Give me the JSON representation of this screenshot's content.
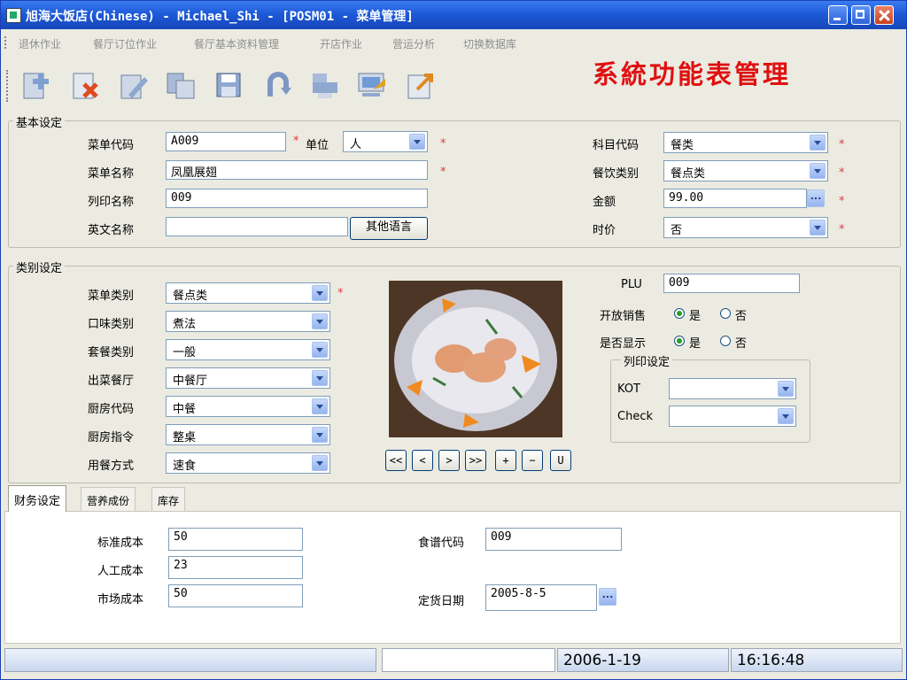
{
  "window": {
    "title": "旭海大饭店(Chinese) - Michael_Shi - [POSM01 - 菜单管理]"
  },
  "menu": [
    "退休作业",
    "餐厅订位作业",
    "餐厅基本资料管理",
    "开店作业",
    "营运分析",
    "切换数据库"
  ],
  "toolbar": {
    "buttons": [
      {
        "name": "add-icon"
      },
      {
        "name": "delete-icon"
      },
      {
        "name": "edit-icon"
      },
      {
        "name": "copy-icon"
      },
      {
        "name": "save-icon"
      },
      {
        "name": "undo-icon"
      },
      {
        "name": "print-icon"
      },
      {
        "name": "search-icon"
      },
      {
        "name": "exit-icon"
      }
    ]
  },
  "banner": "系統功能表管理",
  "basic": {
    "legend": "基本设定",
    "menu_code_label": "菜单代码",
    "menu_code": "A009",
    "unit_label": "单位",
    "unit": "人",
    "menu_name_label": "菜单名称",
    "menu_name": "凤凰展翅",
    "print_name_label": "列印名称",
    "print_name": "009",
    "english_name_label": "英文名称",
    "english_name": "",
    "other_lang_button": "其他语言",
    "account_code_label": "科目代码",
    "account_code": "餐类",
    "meal_type_label": "餐饮类别",
    "meal_type": "餐点类",
    "amount_label": "金额",
    "amount": "99.00",
    "current_price_label": "时价",
    "current_price": "否",
    "required_mark": "*"
  },
  "category": {
    "legend": "类别设定",
    "fields": [
      {
        "label": "菜单类别",
        "value": "餐点类"
      },
      {
        "label": "口味类别",
        "value": "煮法"
      },
      {
        "label": "套餐类别",
        "value": "一般"
      },
      {
        "label": "出菜餐厅",
        "value": "中餐厅"
      },
      {
        "label": "厨房代码",
        "value": "中餐"
      },
      {
        "label": "厨房指令",
        "value": "整桌"
      },
      {
        "label": "用餐方式",
        "value": "速食"
      }
    ],
    "plu_label": "PLU",
    "plu": "009",
    "open_sale_label": "开放销售",
    "is_display_label": "是否显示",
    "yes": "是",
    "no": "否",
    "print_legend": "列印设定",
    "kot_label": "KOT",
    "kot": "",
    "check_label": "Check",
    "check": ""
  },
  "image_nav": [
    "<<",
    "<",
    ">",
    ">>",
    "+",
    "−",
    "U"
  ],
  "tabs": [
    {
      "label": "财务设定",
      "active": true
    },
    {
      "label": "营养成份",
      "active": false
    },
    {
      "label": "库存",
      "active": false
    }
  ],
  "finance": {
    "std_cost_label": "标准成本",
    "std_cost": "50",
    "labor_cost_label": "人工成本",
    "labor_cost": "23",
    "market_cost_label": "市场成本",
    "market_cost": "50",
    "recipe_code_label": "食谱代码",
    "recipe_code": "009",
    "order_date_label": "定货日期",
    "order_date": "2005-8-5",
    "date_button": "..."
  },
  "status": {
    "left": "",
    "mid": "",
    "date": "2006-1-19",
    "time": "16:16:48"
  },
  "colors": {
    "banner": "#e01010",
    "title_bar": "#1d5ad8",
    "required": "#e23a3a"
  }
}
